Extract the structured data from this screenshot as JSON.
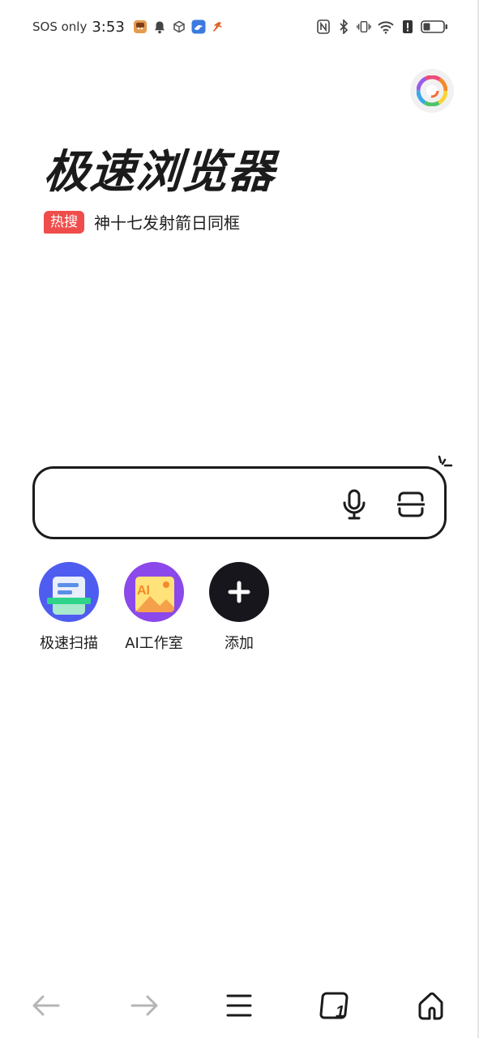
{
  "status_bar": {
    "carrier": "SOS only",
    "time": "3:53",
    "wifi_superscript": "6"
  },
  "header": {
    "title": "极速浏览器"
  },
  "hot_search": {
    "badge": "热搜",
    "text": "神十七发射箭日同框"
  },
  "search": {
    "placeholder": "",
    "value": ""
  },
  "shortcuts": [
    {
      "label": "极速扫描",
      "icon": "scanner-icon"
    },
    {
      "label": "AI工作室",
      "icon": "ai-studio-icon",
      "icon_text": "AI"
    },
    {
      "label": "添加",
      "icon": "plus-icon"
    }
  ],
  "bottom_nav": {
    "tabs_count": "1"
  },
  "colors": {
    "accent_red": "#ef4d4b",
    "dark": "#1b1b1b"
  }
}
